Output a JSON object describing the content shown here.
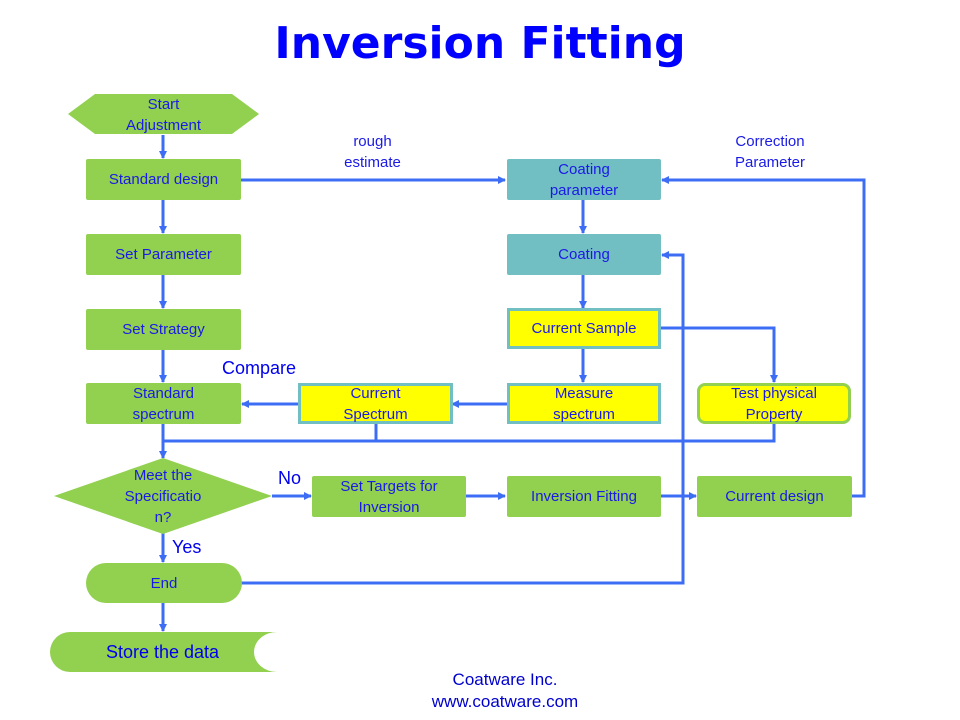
{
  "title": "Inversion Fitting",
  "colors": {
    "process_green": "#92d050",
    "process_teal": "#72bfc3",
    "highlight_yellow": "#ffff00",
    "connector_blue": "#3d6cf5",
    "text_blue": "#1a1ae6",
    "title_blue": "#0000ff"
  },
  "nodes": {
    "start": "Start\nAdjustment",
    "standard_design": "Standard  design",
    "set_parameter": "Set Parameter",
    "set_strategy": "Set Strategy",
    "standard_spectrum": "Standard\nspectrum",
    "current_spectrum": "Current\nSpectrum",
    "coating_parameter": "Coating\nparameter",
    "coating": "Coating",
    "current_sample": "Current  Sample",
    "measure_spectrum": "Measure\nspectrum",
    "test_physical_property": "Test  physical\nProperty",
    "decision": "Meet  the\nSpecificatio\nn?",
    "set_targets": "Set Targets  for\nInversion",
    "inversion_fitting": "Inversion  Fitting",
    "current_design": "Current  design",
    "end": "End",
    "store_data": "Store the data"
  },
  "labels": {
    "rough_estimate": "rough\nestimate",
    "correction_parameter": "Correction\nParameter",
    "compare": "Compare",
    "no": "No",
    "yes": "Yes"
  },
  "footer": {
    "company": "Coatware Inc.",
    "url": "www.coatware.com"
  }
}
